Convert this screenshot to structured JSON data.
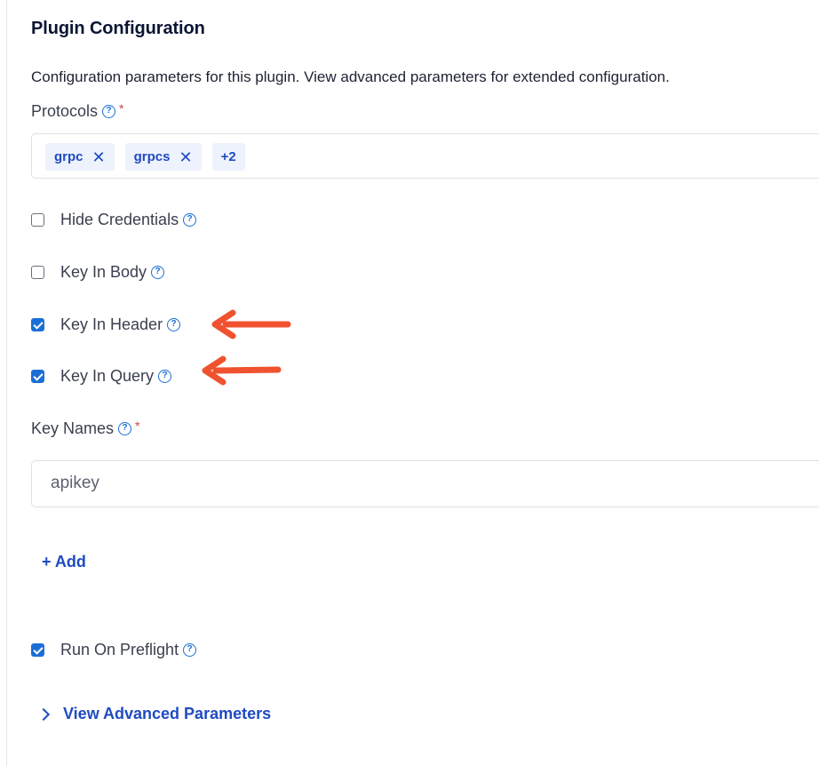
{
  "section": {
    "title": "Plugin Configuration",
    "description": "Configuration parameters for this plugin. View advanced parameters for extended configuration."
  },
  "protocols": {
    "label": "Protocols",
    "required": "*",
    "tags": [
      "grpc",
      "grpcs"
    ],
    "more": "+2"
  },
  "options": [
    {
      "label": "Hide Credentials",
      "checked": false
    },
    {
      "label": "Key In Body",
      "checked": false
    },
    {
      "label": "Key In Header",
      "checked": true
    },
    {
      "label": "Key In Query",
      "checked": true
    }
  ],
  "key_names": {
    "label": "Key Names",
    "required": "*",
    "value": "apikey"
  },
  "add_label": "+ Add",
  "run_on_preflight": {
    "label": "Run On Preflight",
    "checked": true
  },
  "advanced_label": "View Advanced Parameters",
  "colors": {
    "accent": "#1a6fd6",
    "link": "#1f4bc2",
    "annotation_arrow": "#f0522f"
  }
}
